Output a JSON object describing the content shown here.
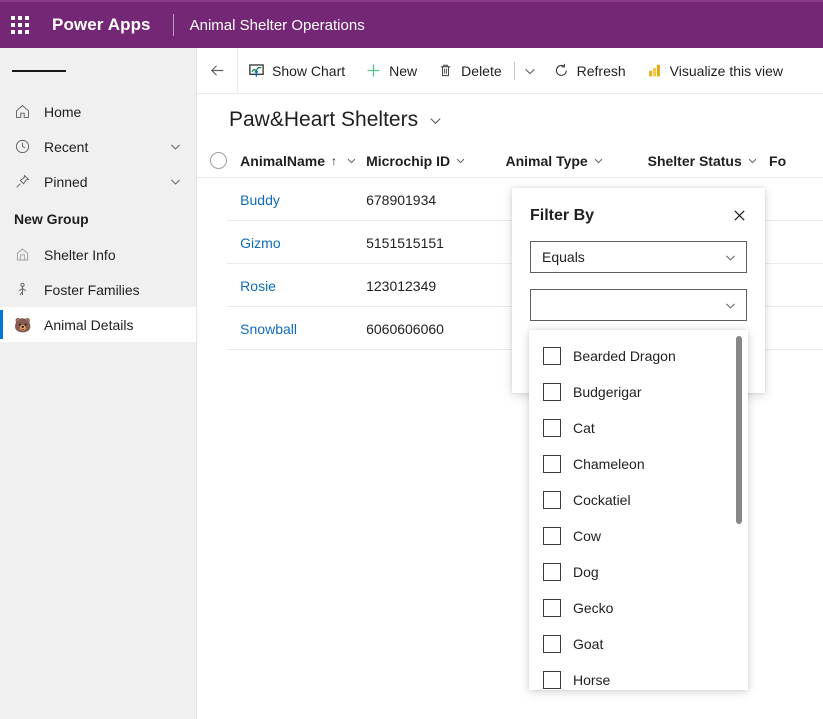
{
  "topbar": {
    "waffle_icon": "waffle-grid-icon",
    "brand": "Power Apps",
    "app_name": "Animal Shelter Operations",
    "background_color": "#742774"
  },
  "sidebar": {
    "hamburger_icon": "hamburger-menu-icon",
    "items": [
      {
        "label": "Home",
        "icon": "home-icon",
        "chevron": false,
        "selected": false
      },
      {
        "label": "Recent",
        "icon": "clock-icon",
        "chevron": true,
        "selected": false
      },
      {
        "label": "Pinned",
        "icon": "pin-icon",
        "chevron": true,
        "selected": false
      }
    ],
    "group_title": "New Group",
    "group_items": [
      {
        "label": "Shelter Info",
        "icon": "building-icon",
        "selected": false
      },
      {
        "label": "Foster Families",
        "icon": "person-icon",
        "selected": false
      },
      {
        "label": "Animal Details",
        "icon": "animal-face-icon",
        "selected": true,
        "emoji": "🐻"
      }
    ],
    "selected_accent_color": "#0078d4"
  },
  "commandbar": {
    "back_icon": "back-arrow-icon",
    "buttons": [
      {
        "label": "Show Chart",
        "icon": "show-chart-icon"
      },
      {
        "label": "New",
        "icon": "plus-icon"
      },
      {
        "label": "Delete",
        "icon": "trash-icon"
      }
    ],
    "overflow_icon": "chevron-down-icon",
    "refresh": {
      "label": "Refresh",
      "icon": "refresh-icon"
    },
    "visualize": {
      "label": "Visualize this view",
      "icon": "powerbi-bars-icon"
    }
  },
  "view": {
    "title": "Paw&Heart Shelters",
    "title_chevron_icon": "chevron-down-icon"
  },
  "grid": {
    "select_all_icon": "select-all-circle-icon",
    "columns": [
      {
        "key": "name",
        "label": "AnimalName",
        "sorted": true,
        "sort_glyph": "↑"
      },
      {
        "key": "chip",
        "label": "Microchip ID",
        "sorted": false,
        "sort_glyph": ""
      },
      {
        "key": "type",
        "label": "Animal Type",
        "sorted": false,
        "sort_glyph": ""
      },
      {
        "key": "status",
        "label": "Shelter Status",
        "sorted": false,
        "sort_glyph": ""
      },
      {
        "key": "fo",
        "label": "Fo",
        "sorted": false,
        "sort_glyph": ""
      }
    ],
    "rows": [
      {
        "name": "Buddy",
        "chip": "678901934",
        "type": "",
        "status": "",
        "fo": ""
      },
      {
        "name": "Gizmo",
        "chip": "5151515151",
        "type": "",
        "status": "",
        "fo": ""
      },
      {
        "name": "Rosie",
        "chip": "123012349",
        "type": "",
        "status": "",
        "fo": ""
      },
      {
        "name": "Snowball",
        "chip": "6060606060",
        "type": "",
        "status": "",
        "fo": ""
      }
    ],
    "link_color": "#0f6cbd"
  },
  "filter_panel": {
    "title": "Filter By",
    "close_icon": "close-x-icon",
    "operator_dropdown": {
      "value": "Equals",
      "chevron_icon": "chevron-down-icon"
    },
    "value_dropdown": {
      "value": "",
      "chevron_icon": "chevron-down-icon"
    },
    "options": [
      {
        "label": "Bearded Dragon",
        "checked": false
      },
      {
        "label": "Budgerigar",
        "checked": false
      },
      {
        "label": "Cat",
        "checked": false
      },
      {
        "label": "Chameleon",
        "checked": false
      },
      {
        "label": "Cockatiel",
        "checked": false
      },
      {
        "label": "Cow",
        "checked": false
      },
      {
        "label": "Dog",
        "checked": false
      },
      {
        "label": "Gecko",
        "checked": false
      },
      {
        "label": "Goat",
        "checked": false
      },
      {
        "label": "Horse",
        "checked": false
      }
    ]
  }
}
